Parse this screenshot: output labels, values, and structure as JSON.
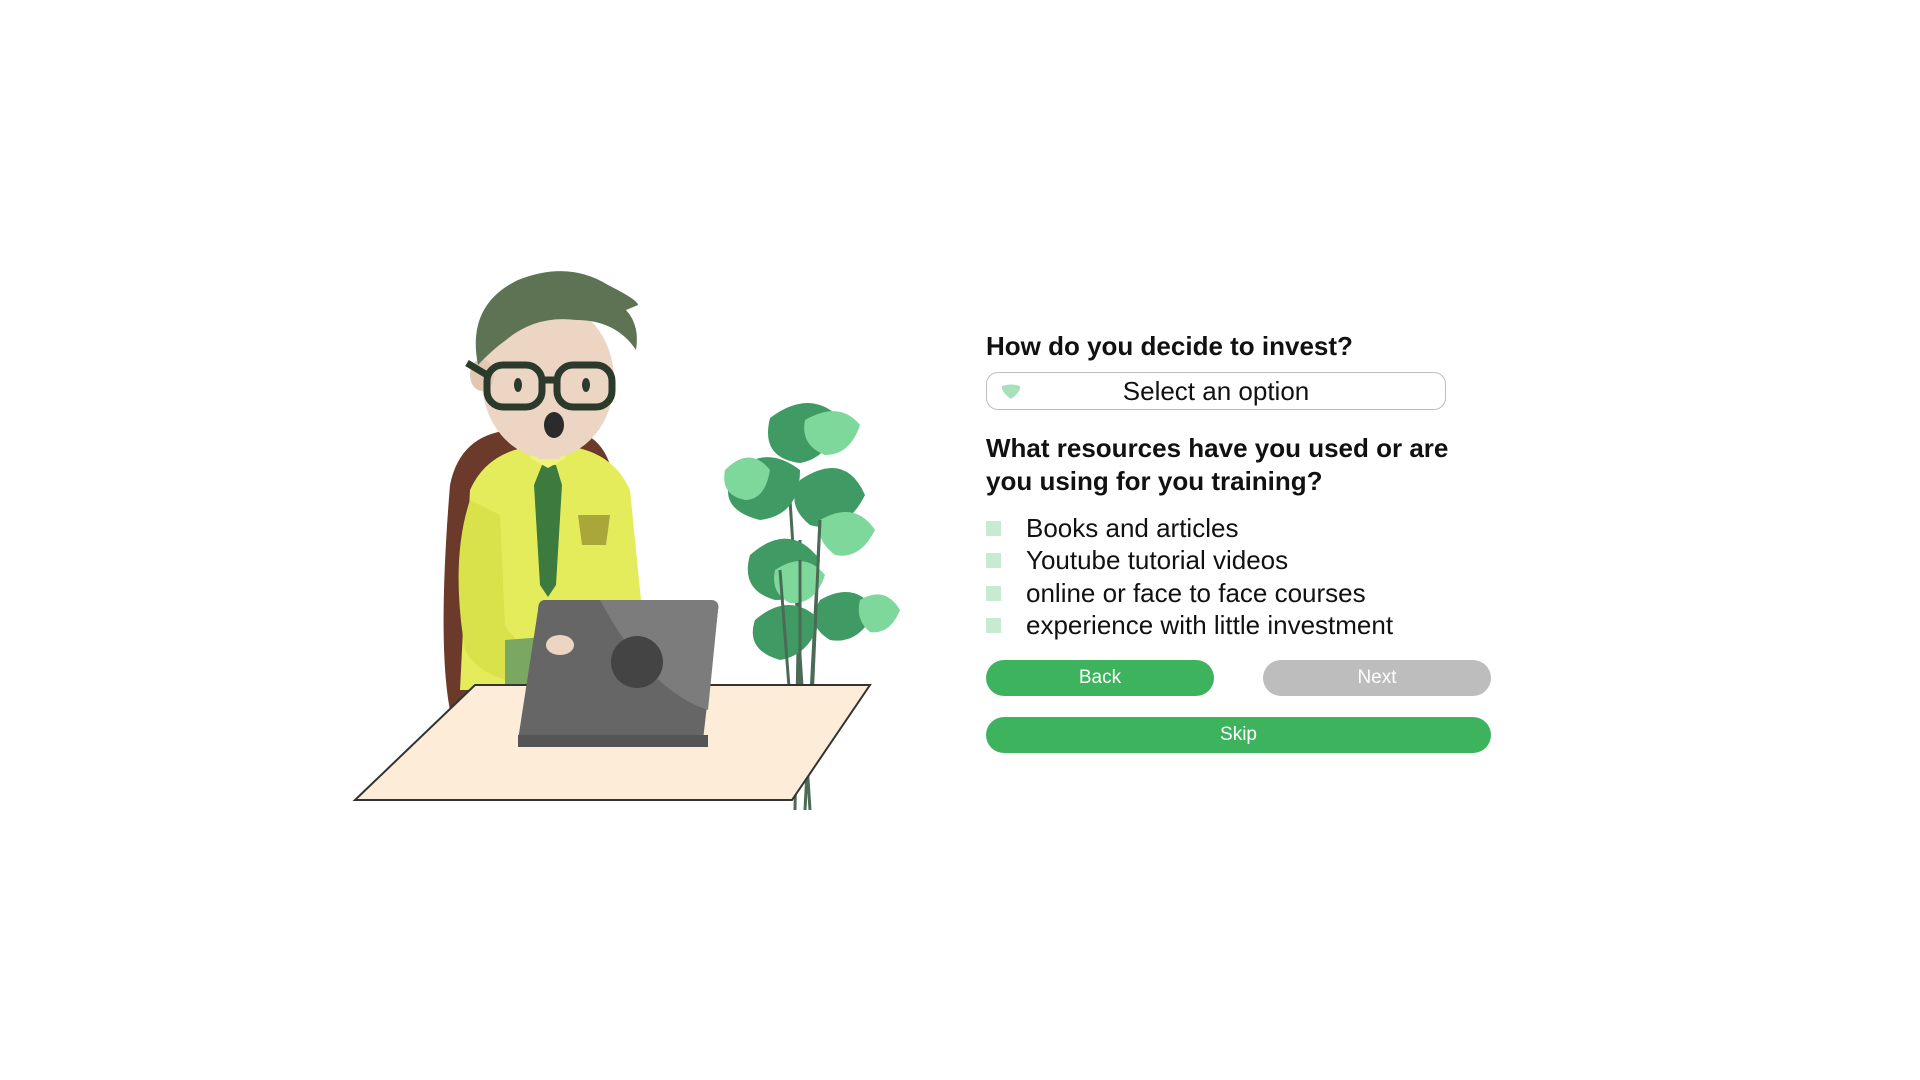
{
  "question1": {
    "title": "How do you decide to invest?",
    "select_value": "Select an option",
    "select_icon": "chevron-down-icon"
  },
  "question2": {
    "title": "What resources have you used or are you using for you training?",
    "options": [
      {
        "label": "Books and articles",
        "checked": false
      },
      {
        "label": "Youtube tutorial videos",
        "checked": false
      },
      {
        "label": "online or face to face courses",
        "checked": false
      },
      {
        "label": "experience with little investment",
        "checked": false
      }
    ]
  },
  "buttons": {
    "back": "Back",
    "next": "Next",
    "skip": "Skip"
  },
  "colors": {
    "primary": "#3db35e",
    "disabled": "#bdbdbd",
    "checkbox": "#c8ead0",
    "chevron": "#a8e0bb"
  }
}
